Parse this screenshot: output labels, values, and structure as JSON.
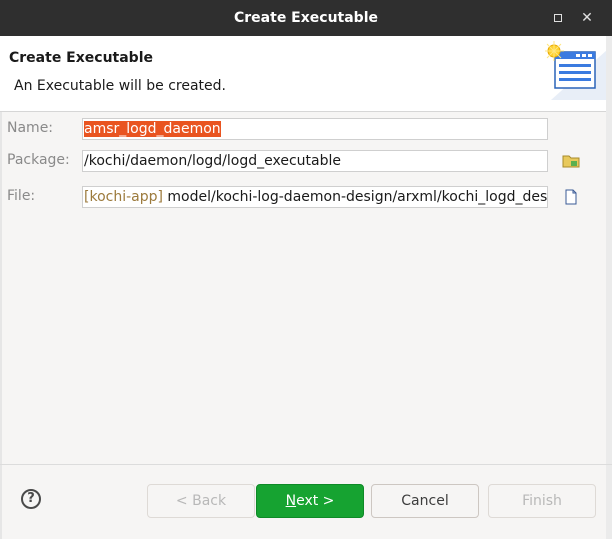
{
  "window": {
    "title": "Create Executable",
    "maximize_icon": "maximize-icon",
    "close_icon": "close-icon",
    "close_glyph": "✕"
  },
  "banner": {
    "heading": "Create Executable",
    "description": "An Executable will be created.",
    "icon": "new-window-wizard-icon"
  },
  "form": {
    "name": {
      "label": "Name:",
      "value": "amsr_logd_daemon"
    },
    "package": {
      "label": "Package:",
      "value": "/kochi/daemon/logd/logd_executable",
      "browse_icon": "folder-icon"
    },
    "file": {
      "label": "File:",
      "prefix": "[kochi-app]",
      "value": " model/kochi-log-daemon-design/arxml/kochi_logd_design",
      "browse_icon": "file-icon"
    }
  },
  "footer": {
    "help_glyph": "?",
    "back_label": "< Back",
    "next_mnemonic": "N",
    "next_rest": "ext >",
    "cancel_label": "Cancel",
    "finish_label": "Finish"
  },
  "colors": {
    "accent": "#16a331",
    "selection": "#e95420",
    "titlebar": "#2f2f2f"
  }
}
